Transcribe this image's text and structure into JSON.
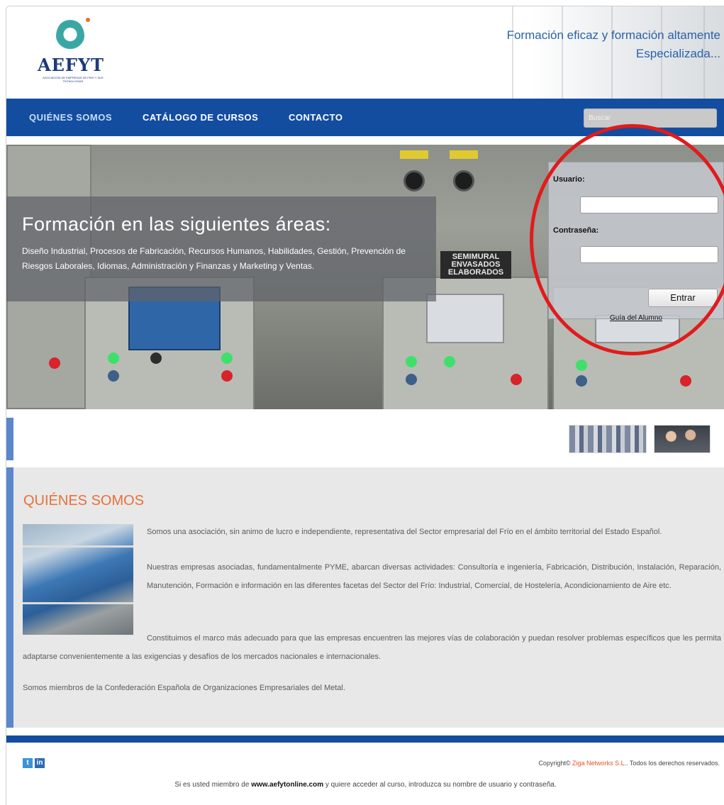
{
  "brand": {
    "logo_text": "AEFYT",
    "logo_subtitle": "ASOCIACIÓN DE EMPRESAS DE FRÍO Y SUS TECNOLOGÍAS",
    "tagline_line1": "Formación eficaz y formación altamente",
    "tagline_line2": "Especializada..."
  },
  "nav": {
    "items": [
      {
        "label": "QUIÉNES SOMOS"
      },
      {
        "label": "CATÁLOGO DE CURSOS"
      },
      {
        "label": "CONTACTO"
      }
    ],
    "search_placeholder": "Buscar"
  },
  "hero": {
    "title": "Formación en las siguientes áreas:",
    "text": "Diseño Industrial, Procesos de Fabricación, Recursos Humanos, Habilidades, Gestión, Prevención de Riesgos Laborales, Idiomas, Administración y Finanzas y Marketing y Ventas.",
    "sign_text": "SEMIMURAL ENVASADOS ELABORADOS"
  },
  "login": {
    "user_label": "Usuario:",
    "password_label": "Contraseña:",
    "submit_label": "Entrar",
    "guide_link": "Guía del Alumno",
    "highlight_color": "#e11b1b"
  },
  "about": {
    "title": "QUIÉNES SOMOS",
    "paragraphs": [
      "Somos una asociación, sin animo de lucro e independiente, representativa del Sector empresarial del Frío en el ámbito territorial del Estado Español.",
      "Nuestras empresas asociadas, fundamentalmente PYME, abarcan diversas actividades: Consultoría e ingeniería, Fabricación, Distribución, Instalación, Reparación, Manutención, Formación e información en las diferentes facetas del Sector del Frío: Industrial, Comercial, de Hostelería, Acondicionamiento de Aire etc.",
      "Constituimos el marco más adecuado para que las empresas encuentren las mejores vías de colaboración y puedan resolver problemas específicos que les permita adaptarse convenientemente a las exigencias y desafíos de los mercados nacionales e internacionales.",
      "Somos miembros de la Confederación Española de Organizaciones Empresariales del Metal."
    ]
  },
  "footer": {
    "copyright_prefix": "Copyright©",
    "copyright_brand": "Ziga Networks S.L.",
    "copyright_suffix": "Todos los derechos reservados.",
    "member_prefix": "Si es usted miembro de",
    "member_site": "www.aefytonline.com",
    "member_suffix": "y quiere acceder al curso, introduzca su nombre de usuario y contraseña.",
    "social": {
      "twitter": "t",
      "linkedin": "in"
    }
  },
  "colors": {
    "nav_bg": "#134da0",
    "accent_blue": "#5b87cc",
    "title_orange": "#e8703a",
    "tagline_blue": "#2a62a8"
  }
}
